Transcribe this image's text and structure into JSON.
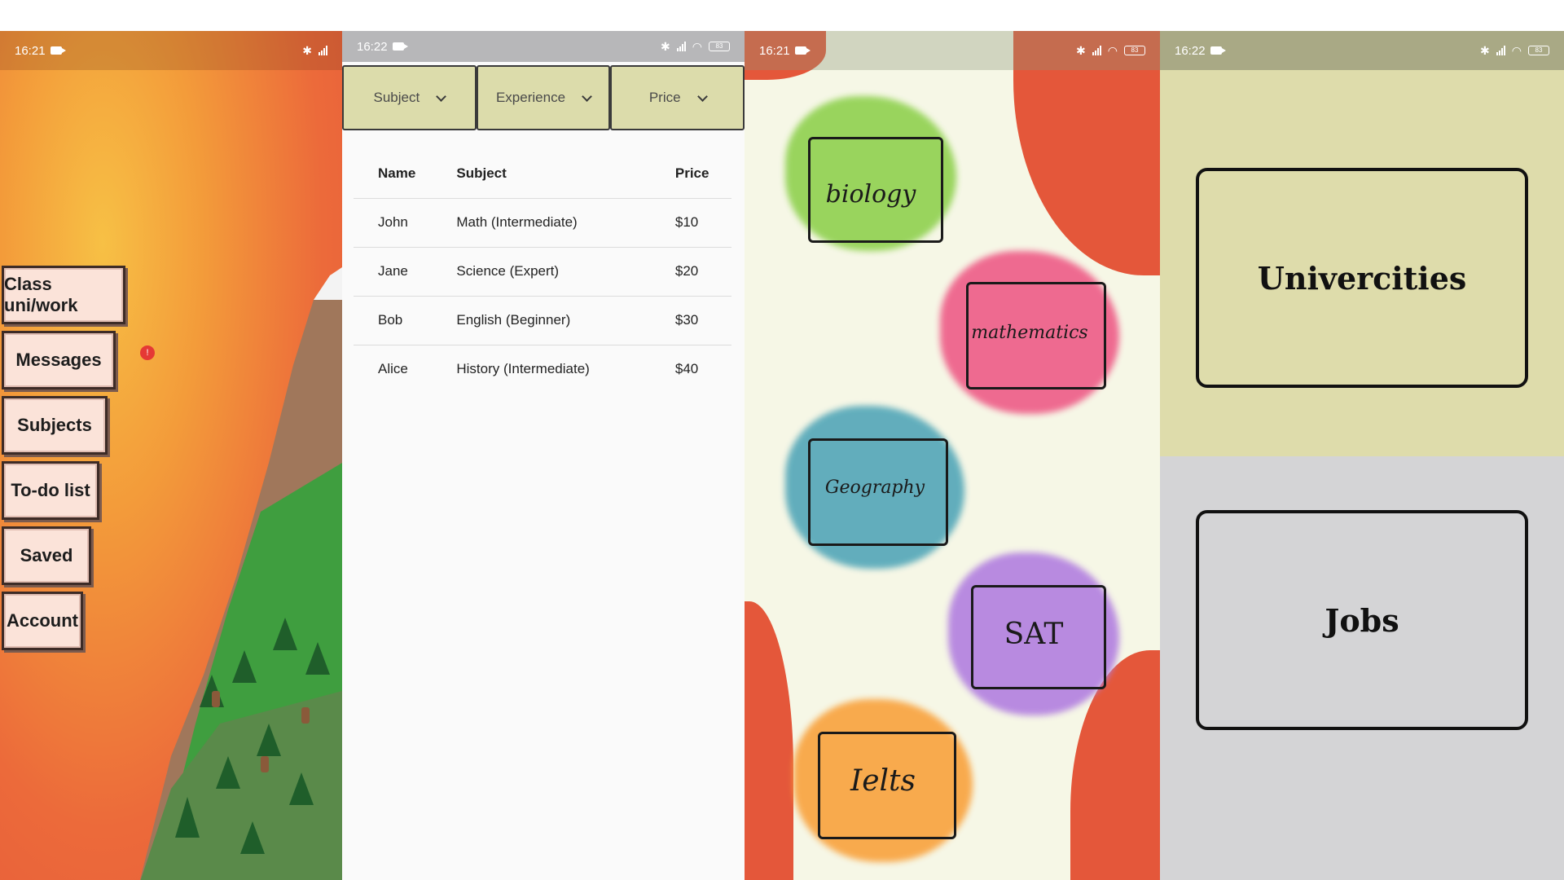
{
  "screen1": {
    "status": {
      "time": "16:21"
    },
    "menu": [
      {
        "label": "Class uni/work"
      },
      {
        "label": "Messages"
      },
      {
        "label": "Subjects"
      },
      {
        "label": "To-do list"
      },
      {
        "label": "Saved"
      },
      {
        "label": "Account"
      }
    ],
    "messages_badge": "!"
  },
  "screen2": {
    "status": {
      "time": "16:22",
      "battery": "83"
    },
    "filters": {
      "subject": "Subject",
      "experience": "Experience",
      "price": "Price"
    },
    "table": {
      "headers": [
        "Name",
        "Subject",
        "Price"
      ],
      "rows": [
        [
          "John",
          "Math (Intermediate)",
          "$10"
        ],
        [
          "Jane",
          "Science (Expert)",
          "$20"
        ],
        [
          "Bob",
          "English (Beginner)",
          "$30"
        ],
        [
          "Alice",
          "History (Intermediate)",
          "$40"
        ]
      ]
    }
  },
  "screen3": {
    "status": {
      "time": "16:21",
      "battery": "83"
    },
    "cards": [
      {
        "label": "biology",
        "color": "#8fd14f"
      },
      {
        "label": "mathematics",
        "color": "#ee5b87"
      },
      {
        "label": "Geography",
        "color": "#52a6b8"
      },
      {
        "label": "SAT",
        "color": "#b27fe0"
      },
      {
        "label": "Ielts",
        "color": "#f9a23d"
      }
    ]
  },
  "screen4": {
    "status": {
      "time": "16:22",
      "battery": "83"
    },
    "universities_label": "Univercities",
    "jobs_label": "Jobs"
  }
}
